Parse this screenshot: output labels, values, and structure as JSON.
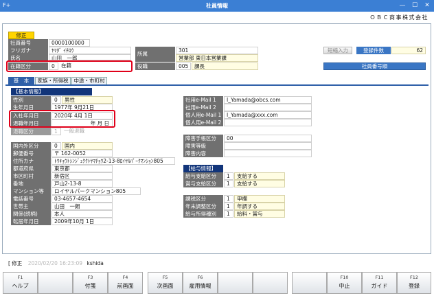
{
  "window": {
    "title": "社員情報",
    "app_icon": "F+",
    "min_glyph": "—",
    "max_glyph": "☐",
    "close_glyph": "✕"
  },
  "company": "ＯＢＣ商事株式会社",
  "mode_badge": "修正",
  "header": {
    "employee_no": {
      "label": "社員番号",
      "value": "0000100000"
    },
    "furigana": {
      "label": "フリガナ",
      "value": "ﾔﾏﾀﾞ ｲﾁﾛｳ"
    },
    "name": {
      "label": "氏名",
      "value": "山田　一郎"
    },
    "status": {
      "label": "在籍区分",
      "code": "0",
      "value": "在籍"
    },
    "dept": {
      "label": "所属",
      "code": "301",
      "value": "営業部 東日本営業課"
    },
    "title": {
      "label": "役職",
      "code": "005",
      "value": "課長"
    },
    "short_input_button": "短縮入力",
    "count_label": "登録件数",
    "count_value": "62",
    "order_button": "社員番号順"
  },
  "tabs": [
    "基　本",
    "家族・所得税",
    "中途・市町村"
  ],
  "basic": {
    "section_title": "【基本情報】",
    "gender": {
      "label": "性別",
      "code": "0",
      "value": "男性"
    },
    "birth": {
      "label": "生年月日",
      "value": "1977年  9月21日"
    },
    "hire": {
      "label": "入社年月日",
      "value": "2020年  4月  1日"
    },
    "retire": {
      "label": "退職年月日",
      "value": "年   月   日"
    },
    "retire_reason": {
      "label": "退職区分",
      "code": "1",
      "value": "一般退職"
    }
  },
  "address": {
    "country": {
      "label": "国内外区分",
      "code": "0",
      "value": "国内"
    },
    "zip": {
      "label": "郵便番号",
      "value": "〒  162-0052"
    },
    "kana": {
      "label": "住所カナ",
      "value": "ﾄｳｷｮｳﾄｼﾝｼﾞｭｸｸﾄﾔﾏﾁｮｳ2-13-8ﾛｲﾔﾙﾊﾟｰｸﾏﾝｼｮﾝ805"
    },
    "pref": {
      "label": "都道府県",
      "value": "東京都"
    },
    "city": {
      "label": "市区町村",
      "value": "新宿区"
    },
    "street": {
      "label": "番地",
      "value": "戸山2-13-8"
    },
    "building": {
      "label": "マンション等",
      "value": "ロイヤルパークマンション805"
    },
    "phone": {
      "label": "電話番号",
      "value": "03-4657-4654"
    },
    "householder": {
      "label": "世帯主",
      "value": "山田　一朗"
    },
    "relation": {
      "label": "関係(続柄)",
      "value": "本人"
    },
    "moved": {
      "label": "転居年月日",
      "value": "2009年10月  1日"
    }
  },
  "contact": {
    "company_mail1": {
      "label": "社用e-Mail 1",
      "value": "I_Yamada@obcs.com"
    },
    "company_mail2": {
      "label": "社用e-Mail 2",
      "value": ""
    },
    "personal_mail1": {
      "label": "個人用e-Mail 1",
      "value": "I_Yamada@xxx.com"
    },
    "personal_mail2": {
      "label": "個人用e-Mail 2",
      "value": ""
    }
  },
  "disability": {
    "book": {
      "label": "障害手帳区分",
      "value": "00"
    },
    "grade": {
      "label": "障害等級",
      "value": ""
    },
    "detail": {
      "label": "障害内容",
      "value": ""
    }
  },
  "salary": {
    "section_title": "【給与情報】",
    "pay": {
      "label": "給与支給区分",
      "code": "1",
      "value": "支給する"
    },
    "bonus": {
      "label": "賞与支給区分",
      "code": "1",
      "value": "支給する"
    },
    "tax": {
      "label": "課税区分",
      "code": "1",
      "value": "甲欄"
    },
    "yearend": {
      "label": "年末調整区分",
      "code": "1",
      "value": "年調する"
    },
    "income_type": {
      "label": "給与所得種別",
      "code": "1",
      "value": "給料・賞与"
    }
  },
  "status_bar": {
    "mode": "[ 修正",
    "timestamp": "2020/02/20 16:23:09",
    "user": "kshida"
  },
  "fkeys": [
    {
      "key": "F1",
      "label": "ヘルプ"
    },
    {
      "key": "",
      "label": ""
    },
    {
      "key": "F3",
      "label": "付箋"
    },
    {
      "key": "F4",
      "label": "前画面"
    },
    {
      "key": "F5",
      "label": "次画面"
    },
    {
      "key": "F6",
      "label": "雇用情報"
    },
    {
      "key": "",
      "label": ""
    },
    {
      "key": "",
      "label": ""
    },
    {
      "key": "",
      "label": ""
    },
    {
      "key": "F10",
      "label": "中止"
    },
    {
      "key": "F11",
      "label": "ガイド"
    },
    {
      "key": "F12",
      "label": "登録"
    }
  ]
}
